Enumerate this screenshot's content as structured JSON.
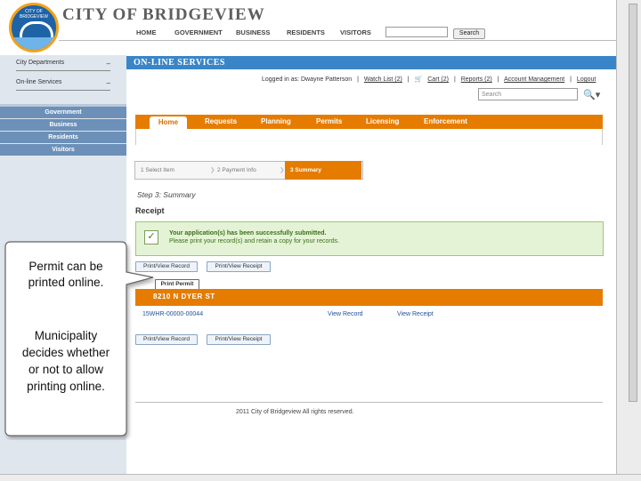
{
  "header": {
    "city_title": "CITY OF BRIDGEVIEW",
    "nav": [
      "HOME",
      "GOVERNMENT",
      "BUSINESS",
      "RESIDENTS",
      "VISITORS"
    ],
    "search_button": "Search"
  },
  "sidebar": {
    "dropdowns": [
      {
        "label": "City Departments",
        "icon": "–"
      },
      {
        "label": "On-line Services",
        "icon": "–"
      }
    ],
    "links": [
      "Government",
      "Business",
      "Residents",
      "Visitors"
    ]
  },
  "online_services": {
    "title": "ON-LINE SERVICES",
    "user_bar": {
      "logged_in": "Logged in as: Dwayne Patterson",
      "watch_list": "Watch List (2)",
      "cart": "Cart (2)",
      "reports": "Reports (2)",
      "account": "Account Management",
      "logout": "Logout"
    },
    "search_placeholder": "Search",
    "tabs": [
      "Home",
      "Requests",
      "Planning",
      "Permits",
      "Licensing",
      "Enforcement"
    ],
    "steps": [
      "1  Select Item",
      "2  Payment Info",
      "3  Summary"
    ],
    "step_heading": "Step 3: Summary",
    "receipt_heading": "Receipt",
    "success_line1": "Your application(s) has been successfully submitted.",
    "success_line2": "Please print your record(s) and retain a copy for your records.",
    "buttons": {
      "print_view_record": "Print/View Record",
      "print_view_receipt": "Print/View Receipt",
      "print_permit": "Print Permit"
    },
    "record": {
      "address": "8210 N DYER ST",
      "number": "15WHR-00000-00044",
      "view_record": "View Record",
      "view_receipt": "View Receipt"
    },
    "footer": "2011 City of Bridgeview All rights reserved."
  },
  "callout": {
    "text1": "Permit can be printed online.",
    "text2": "Municipality decides whether or not to allow printing online."
  },
  "colors": {
    "orange": "#e57c00",
    "blue_bar": "#3a85c8",
    "sidebar_link": "#6c90b8",
    "success_bg": "#e4f3d5"
  }
}
